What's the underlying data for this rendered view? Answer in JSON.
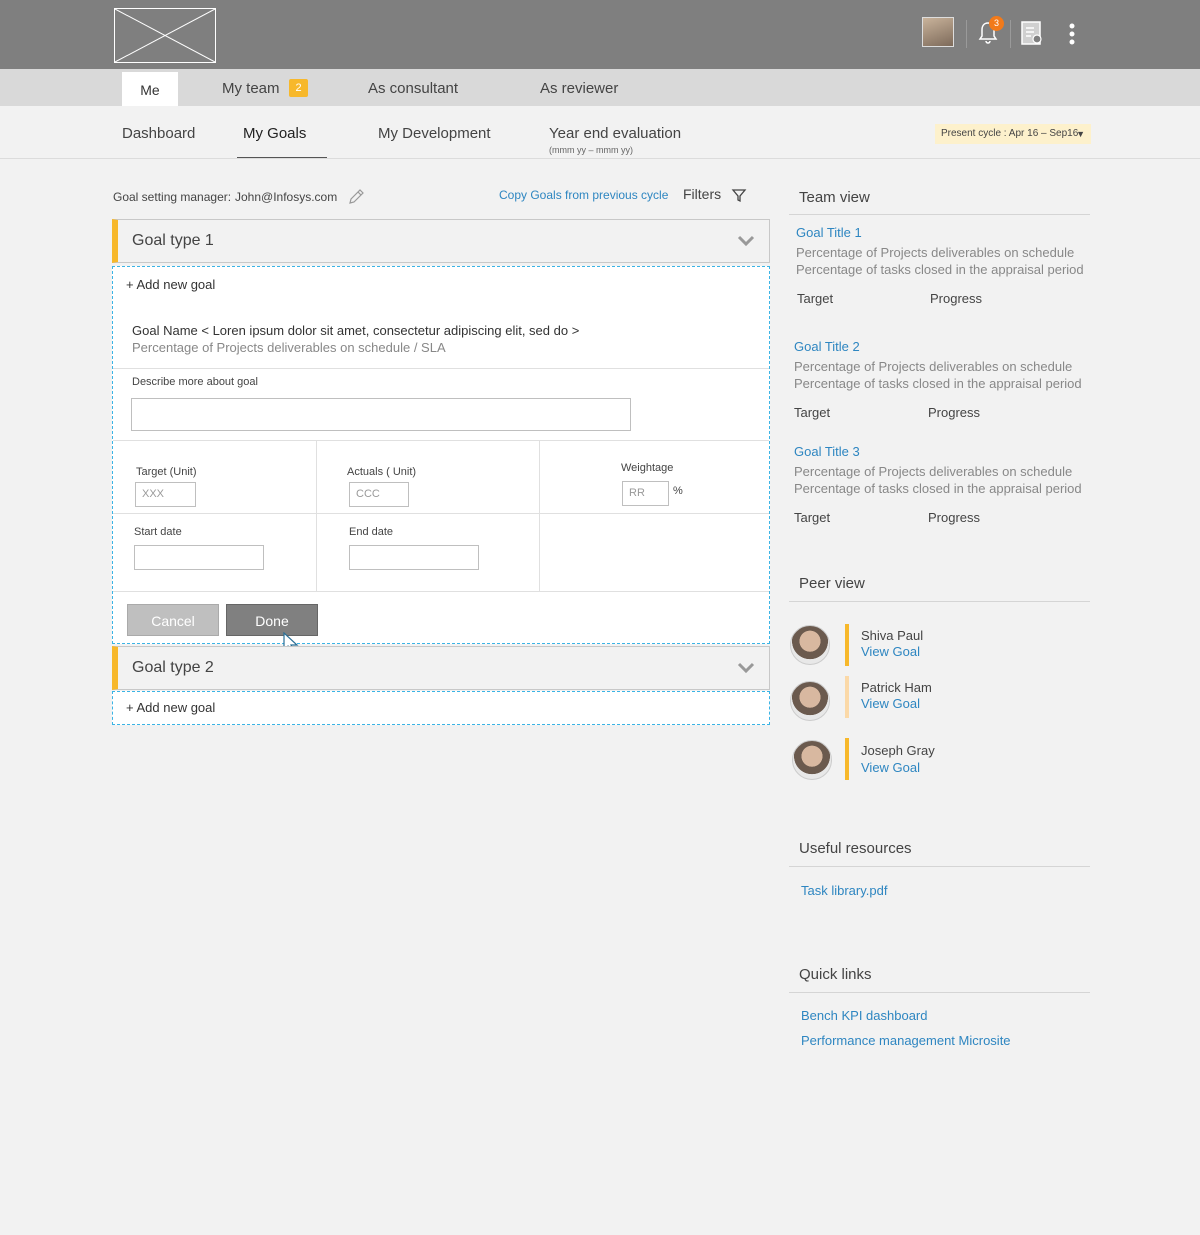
{
  "header": {
    "notification_count": "3"
  },
  "roles": {
    "me": "Me",
    "my_team": "My team",
    "my_team_badge": "2",
    "consultant": "As consultant",
    "reviewer": "As reviewer"
  },
  "subnav": {
    "dashboard": "Dashboard",
    "my_goals": "My Goals",
    "my_development": "My Development",
    "year_end": "Year end evaluation",
    "year_end_hint": "(mmm yy – mmm yy)",
    "cycle": "Present cycle : Apr 16 – Sep16"
  },
  "goals": {
    "manager_label": "Goal setting manager:",
    "manager_value": "John@Infosys.com",
    "copy_link": "Copy Goals from previous cycle",
    "filters": "Filters",
    "type1": "Goal type 1",
    "type2": "Goal type 2",
    "add_new": "+ Add new goal",
    "goal_name": "Goal Name < Loren ipsum dolor sit amet, consectetur adipiscing elit, sed do >",
    "goal_sub": "Percentage of Projects deliverables on schedule / SLA",
    "describe_label": "Describe more about goal",
    "target_label": "Target (Unit)",
    "target_value": "XXX",
    "actuals_label": "Actuals ( Unit)",
    "actuals_value": "CCC",
    "weightage_label": "Weightage",
    "weightage_value": "RR",
    "percent": "%",
    "start_label": "Start date",
    "end_label": "End date",
    "cancel": "Cancel",
    "done": "Done"
  },
  "team_view": {
    "heading": "Team view",
    "items": [
      {
        "title": "Goal Title 1",
        "line1": "Percentage of Projects deliverables on schedule",
        "line2": "Percentage of tasks closed in the appraisal period",
        "target": "Target",
        "progress": "Progress"
      },
      {
        "title": "Goal Title 2",
        "line1": "Percentage of Projects deliverables on schedule",
        "line2": "Percentage of tasks closed in the appraisal period",
        "target": "Target",
        "progress": "Progress"
      },
      {
        "title": "Goal Title 3",
        "line1": "Percentage of Projects deliverables on schedule",
        "line2": "Percentage of tasks closed in the appraisal period",
        "target": "Target",
        "progress": "Progress"
      }
    ]
  },
  "peer_view": {
    "heading": "Peer view",
    "peers": [
      {
        "name": "Shiva Paul",
        "link": "View Goal"
      },
      {
        "name": "Patrick Ham",
        "link": "View Goal"
      },
      {
        "name": "Joseph Gray",
        "link": "View Goal"
      }
    ]
  },
  "resources": {
    "heading": "Useful resources",
    "items": [
      "Task library.pdf"
    ]
  },
  "quick_links": {
    "heading": "Quick links",
    "items": [
      "Bench KPI dashboard",
      "Performance management Microsite"
    ]
  },
  "colors": {
    "accent": "#f7b82b",
    "link": "#2e86c1",
    "dashed_border": "#3bb4e5",
    "header_bg": "#7f7f7f"
  }
}
